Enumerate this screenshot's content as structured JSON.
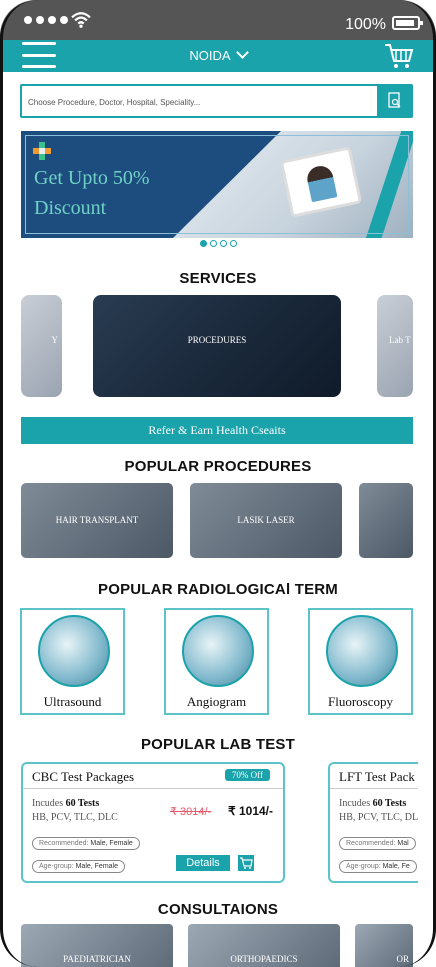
{
  "status_bar": {
    "battery_percent": "100%"
  },
  "header": {
    "location": "NOIDA"
  },
  "search": {
    "placeholder": "Choose Procedure, Doctor, Hospital, Speciality..."
  },
  "banner": {
    "line1": "Get Upto 50%",
    "line2": "Discount",
    "slides": 4,
    "active_slide": 1
  },
  "services": {
    "title": "SERVICES",
    "items": [
      {
        "label": "Y"
      },
      {
        "label": "PROCEDURES"
      },
      {
        "label": "Lab T"
      }
    ]
  },
  "refer": {
    "label": "Refer & Earn Health Cseaits"
  },
  "popular_procedures": {
    "title": "POPULAR PROCEDURES",
    "items": [
      {
        "label": "HAIR TRANSPLANT"
      },
      {
        "label": "LASIK LASER"
      },
      {
        "label": ""
      }
    ]
  },
  "radiological": {
    "title": "POPULAR RADIOLOGICAl TERM",
    "items": [
      {
        "label": "Ultrasound"
      },
      {
        "label": "Angiogram"
      },
      {
        "label": "Fluoroscopy"
      }
    ]
  },
  "lab_tests": {
    "title": "POPULAR LAB TEST",
    "items": [
      {
        "title": "CBC Test Packages",
        "discount": "70% Off",
        "includes_prefix": "Incudes",
        "includes_count": "60 Tests",
        "tests": "HB, PCV, TLC, DLC",
        "old_price": "₹ 3014/-",
        "new_price": "₹ 1014/-",
        "recommended_label": "Recommended:",
        "recommended_value": "Male, Female",
        "age_label": "Age-group:",
        "age_value": "Male, Female",
        "details": "Details"
      },
      {
        "title": "LFT Test Pack",
        "includes_prefix": "Incudes",
        "includes_count": "60 Tests",
        "tests": "HB, PCV, TLC, DL",
        "recommended_label": "Recommended:",
        "recommended_value": "Mal",
        "age_label": "Age-group:",
        "age_value": "Male, Fe"
      }
    ]
  },
  "consultations": {
    "title": "CONSULTAIONS",
    "items": [
      {
        "label": "PAEDIATRICIAN"
      },
      {
        "label": "ORTHOPAEDICS"
      },
      {
        "label": "OR"
      }
    ]
  },
  "colors": {
    "accent": "#1aa3ab",
    "banner_bg": "#1c4d7e",
    "banner_text": "#6fd1c6",
    "strike_price": "#e85a6b",
    "status_bar": "#555555"
  }
}
